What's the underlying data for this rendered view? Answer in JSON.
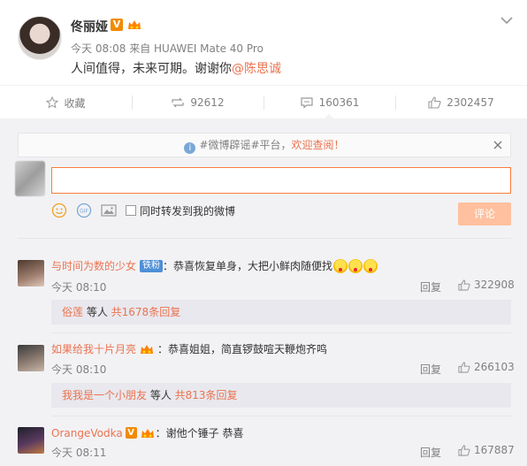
{
  "post": {
    "username": "佟丽娅",
    "verified_mark": "V",
    "meta": "今天 08:08 来自 HUAWEI Mate 40 Pro",
    "text_main": "人间值得，未来可期。谢谢你",
    "mention": "@陈思诚"
  },
  "actions": {
    "favorite": "收藏",
    "repost": "92612",
    "comment": "160361",
    "like": "2302457"
  },
  "notice": {
    "prefix": "#微博辟谣#平台，",
    "highlight": "欢迎查阅！"
  },
  "compose": {
    "input_value": "",
    "repost_label": "同时转发到我的微博",
    "submit_label": "评论"
  },
  "comments": [
    {
      "name": "与时间为数的少女",
      "badge": "铁粉",
      "text": "：恭喜恢复单身，大把小鲜肉随便找",
      "time": "今天 08:10",
      "reply": "回复",
      "likes": "322908",
      "sub_user": "俗莲",
      "sub_mid": " 等人 ",
      "sub_count": "共1678条回复"
    },
    {
      "name": "如果给我十片月亮",
      "text": "：恭喜姐姐，简直锣鼓喧天鞭炮齐鸣",
      "time": "今天 08:10",
      "reply": "回复",
      "likes": "266103",
      "sub_user": "我我是一个小朋友",
      "sub_mid": " 等人 ",
      "sub_count": "共813条回复"
    },
    {
      "name": "OrangeVodka",
      "badge": "V",
      "text": "：谢他个锤子 恭喜",
      "time": "今天 08:11",
      "reply": "回复",
      "likes": "167887"
    }
  ]
}
